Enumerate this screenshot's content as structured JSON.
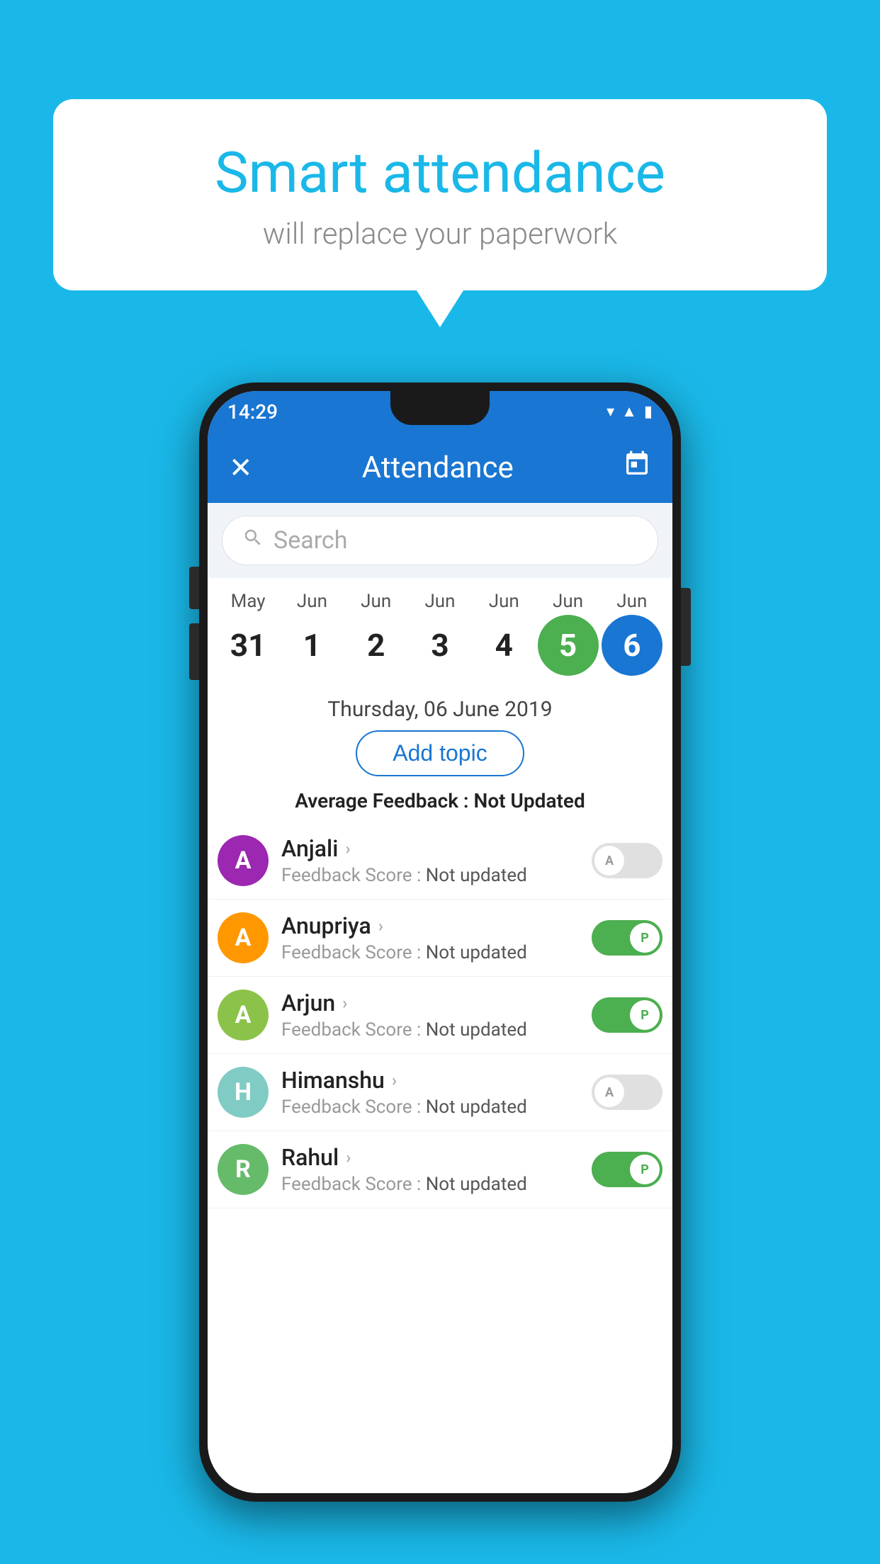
{
  "background_color": "#1ab8e8",
  "speech_bubble": {
    "title": "Smart attendance",
    "subtitle": "will replace your paperwork"
  },
  "status_bar": {
    "time": "14:29",
    "icons": [
      "wifi",
      "signal",
      "battery"
    ]
  },
  "app_bar": {
    "title": "Attendance",
    "close_icon": "✕",
    "calendar_icon": "📅"
  },
  "search": {
    "placeholder": "Search"
  },
  "calendar": {
    "months": [
      "May",
      "Jun",
      "Jun",
      "Jun",
      "Jun",
      "Jun",
      "Jun"
    ],
    "dates": [
      "31",
      "1",
      "2",
      "3",
      "4",
      "5",
      "6"
    ],
    "selected_green_index": 5,
    "selected_blue_index": 6
  },
  "selected_date_label": "Thursday, 06 June 2019",
  "add_topic_label": "Add topic",
  "average_feedback": {
    "label": "Average Feedback :",
    "value": "Not Updated"
  },
  "students": [
    {
      "name": "Anjali",
      "avatar_letter": "A",
      "avatar_color": "purple",
      "feedback_label": "Feedback Score :",
      "feedback_value": "Not updated",
      "toggle_state": "off",
      "toggle_label": "A"
    },
    {
      "name": "Anupriya",
      "avatar_letter": "A",
      "avatar_color": "orange",
      "feedback_label": "Feedback Score :",
      "feedback_value": "Not updated",
      "toggle_state": "on",
      "toggle_label": "P"
    },
    {
      "name": "Arjun",
      "avatar_letter": "A",
      "avatar_color": "light-green",
      "feedback_label": "Feedback Score :",
      "feedback_value": "Not updated",
      "toggle_state": "on",
      "toggle_label": "P"
    },
    {
      "name": "Himanshu",
      "avatar_letter": "H",
      "avatar_color": "teal",
      "feedback_label": "Feedback Score :",
      "feedback_value": "Not updated",
      "toggle_state": "off",
      "toggle_label": "A"
    },
    {
      "name": "Rahul",
      "avatar_letter": "R",
      "avatar_color": "green2",
      "feedback_label": "Feedback Score :",
      "feedback_value": "Not updated",
      "toggle_state": "on",
      "toggle_label": "P"
    }
  ]
}
